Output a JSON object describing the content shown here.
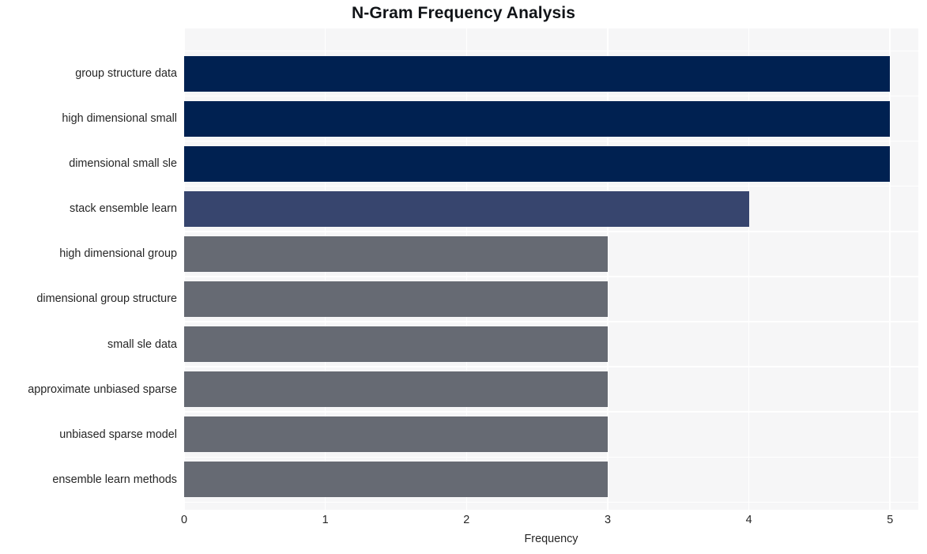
{
  "chart_data": {
    "type": "bar",
    "orientation": "horizontal",
    "title": "N-Gram Frequency Analysis",
    "xlabel": "Frequency",
    "ylabel": "",
    "xlim": [
      0,
      5.2
    ],
    "xticks": [
      "0",
      "1",
      "2",
      "3",
      "4",
      "5"
    ],
    "xtick_values": [
      0,
      1,
      2,
      3,
      4,
      5
    ],
    "grid": true,
    "grid_color": "#ffffff",
    "plot_background": "#f6f6f7",
    "legend": "none",
    "categories": [
      "group structure data",
      "high dimensional small",
      "dimensional small sle",
      "stack ensemble learn",
      "high dimensional group",
      "dimensional group structure",
      "small sle data",
      "approximate unbiased sparse",
      "unbiased sparse model",
      "ensemble learn methods"
    ],
    "values": [
      5,
      5,
      5,
      4,
      3,
      3,
      3,
      3,
      3,
      3
    ],
    "bar_colors": [
      "#002151",
      "#002151",
      "#002151",
      "#37456e",
      "#666a73",
      "#666a73",
      "#666a73",
      "#666a73",
      "#666a73",
      "#666a73"
    ]
  },
  "colors": {
    "title_text": "#111418",
    "tick_text": "#262626",
    "figure_background": "#ffffff"
  }
}
